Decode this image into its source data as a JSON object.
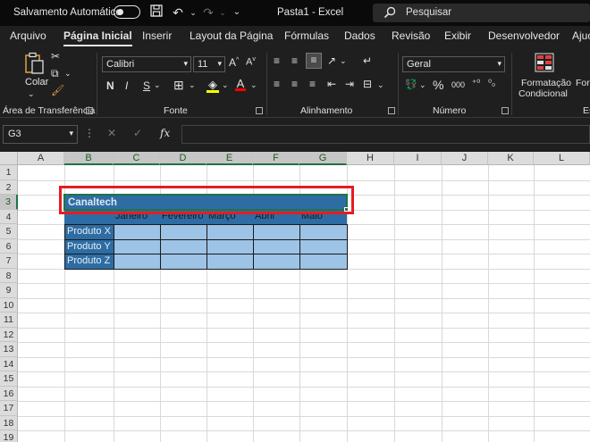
{
  "titlebar": {
    "autosave_label": "Salvamento Automático",
    "doc_title": "Pasta1  -  Excel",
    "search_placeholder": "Pesquisar"
  },
  "tabs": [
    "Arquivo",
    "Página Inicial",
    "Inserir",
    "Layout da Página",
    "Fórmulas",
    "Dados",
    "Revisão",
    "Exibir",
    "Desenvolvedor",
    "Ajuc"
  ],
  "active_tab": "Página Inicial",
  "ribbon": {
    "clipboard": {
      "paste_label": "Colar",
      "group_label": "Área de Transferência"
    },
    "font": {
      "font_name": "Calibri",
      "font_size": "11",
      "group_label": "Fonte",
      "bold": "N",
      "italic": "I",
      "underline": "S"
    },
    "alignment": {
      "group_label": "Alinhamento"
    },
    "number": {
      "format": "Geral",
      "group_label": "Número",
      "percent": "%",
      "thousands": "000"
    },
    "styles": {
      "conditional_formatting_line1": "Formatação",
      "conditional_formatting_line2": "Condicional",
      "format_partial": "For",
      "group_partial": "Es"
    }
  },
  "formula_bar": {
    "name_box": "G3",
    "fx_label": "fx",
    "content": ""
  },
  "columns": [
    "A",
    "B",
    "C",
    "D",
    "E",
    "F",
    "G",
    "H",
    "I",
    "J",
    "K",
    "L"
  ],
  "rows": [
    "1",
    "2",
    "3",
    "4",
    "5",
    "6",
    "7",
    "8",
    "9",
    "10",
    "11",
    "12",
    "13",
    "14",
    "15",
    "16",
    "17",
    "18",
    "19"
  ],
  "table": {
    "title": "Canaltech",
    "headers": [
      "Janeiro",
      "Fevereiro",
      "Março",
      "Abril",
      "Maio"
    ],
    "row_labels": [
      "Produto X",
      "Produto Y",
      "Produto Z"
    ]
  },
  "colors": {
    "header_blue": "#2e6da4",
    "data_blue": "#9dc3e6",
    "selection_green": "#217346",
    "highlight_red": "#e51c23"
  }
}
